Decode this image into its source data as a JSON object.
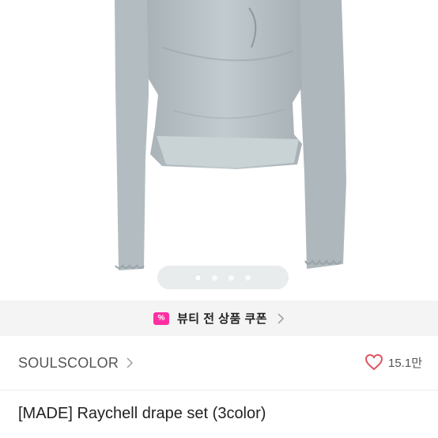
{
  "coupon_banner": {
    "badge_glyph": "%",
    "label": "뷰티 전 상품 쿠폰",
    "accent": "#ff2fa3"
  },
  "image_pager": {
    "count": 4,
    "active_index": 0
  },
  "brand": {
    "name": "SOULSCOLOR",
    "like_count": "15.1만"
  },
  "product": {
    "title": "[MADE] Raychell drape set (3color)"
  },
  "colors": {
    "heart": "#e05260",
    "garment": "#b9c2c6"
  }
}
